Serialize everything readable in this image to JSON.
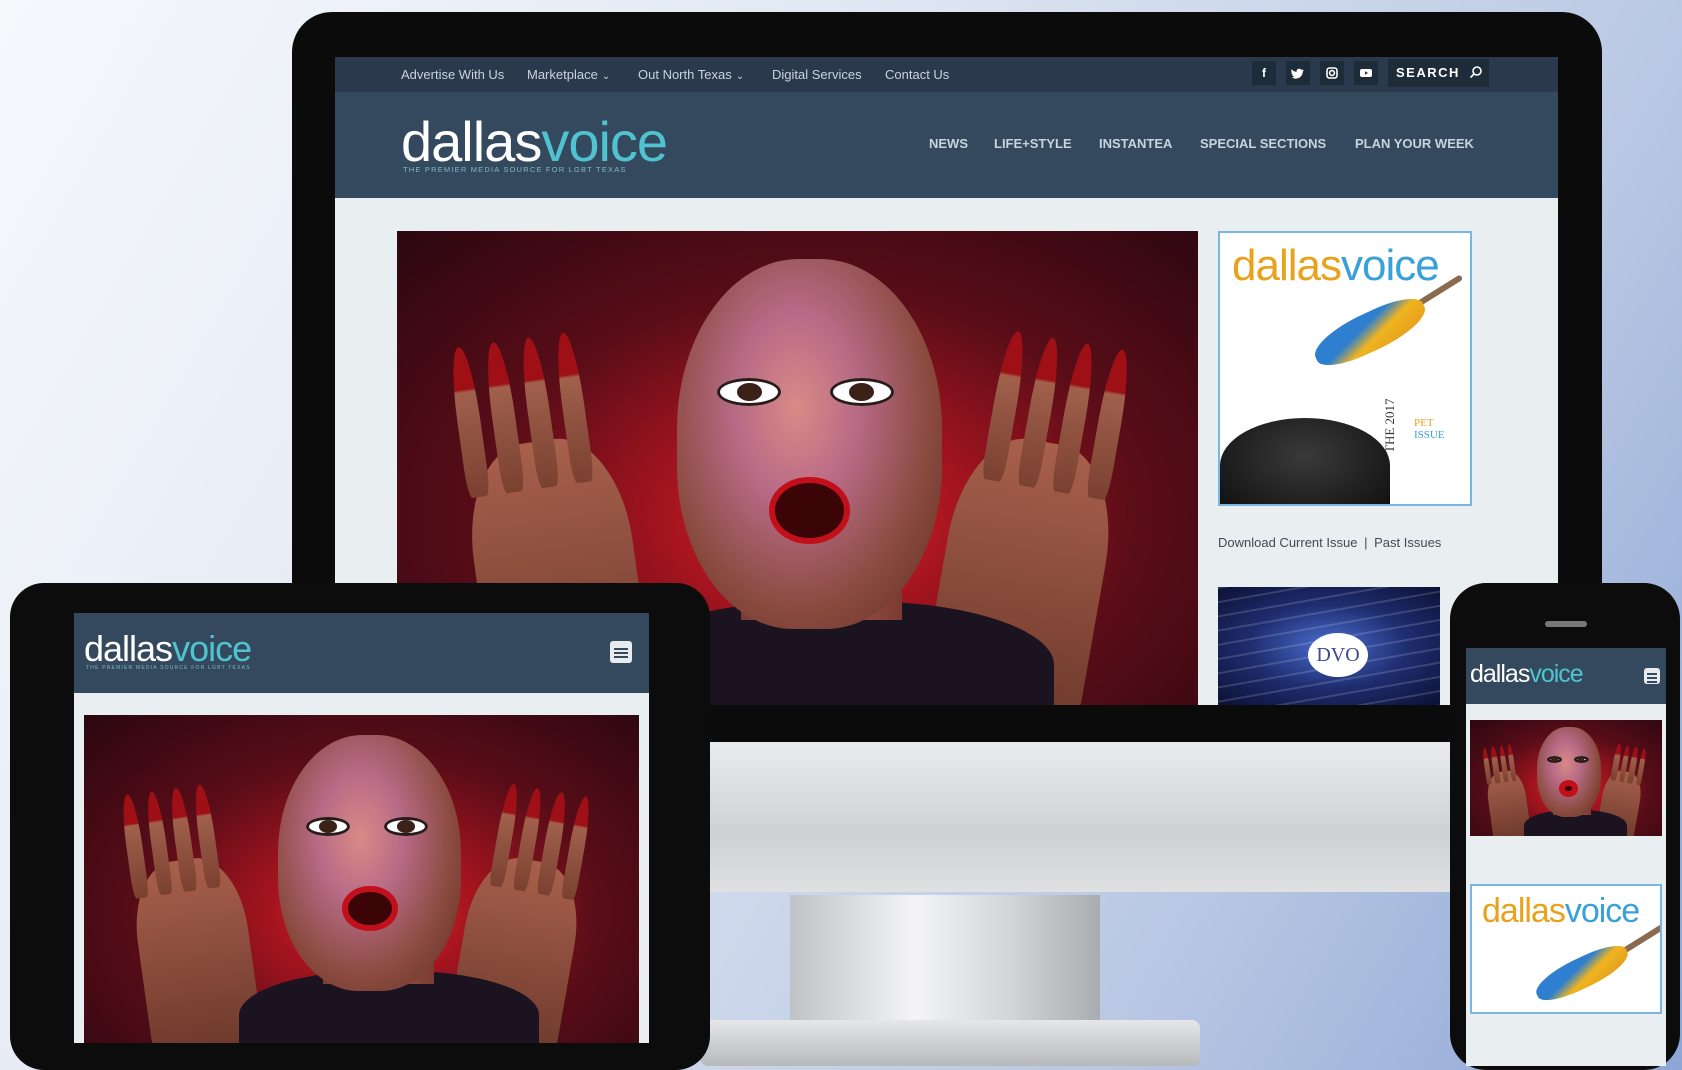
{
  "brand": {
    "logo_part1": "dallas",
    "logo_part2": "voice",
    "tagline": "THE PREMIER MEDIA SOURCE FOR LGBT TEXAS"
  },
  "desktop": {
    "topbar": {
      "links": [
        "Advertise With Us",
        "Marketplace",
        "Out North Texas",
        "Digital Services",
        "Contact Us"
      ],
      "social": [
        "f",
        "t",
        "i",
        "y"
      ],
      "search_label": "SEARCH"
    },
    "mainnav": [
      "NEWS",
      "LIFE+STYLE",
      "INSTANTEA",
      "SPECIAL SECTIONS",
      "PLAN YOUR WEEK"
    ],
    "sidebar": {
      "download_current": "Download Current Issue",
      "separator": "|",
      "past_issues": "Past Issues",
      "dvo_badge": "DVO"
    }
  },
  "cover": {
    "title_part1": "dallas",
    "title_part2": "voice",
    "issue_the": "THE",
    "issue_year": "2017",
    "issue_pet": "PET",
    "issue_label": "ISSUE"
  },
  "colors": {
    "nav_bg": "#34495e",
    "topbar_bg": "#2a3a4c",
    "logo_accent": "#4fc3cf",
    "cover_orange": "#e8a21c",
    "cover_blue": "#3aa0d8"
  },
  "icons": {
    "menu": "hamburger-menu-icon",
    "search": "search-icon"
  }
}
